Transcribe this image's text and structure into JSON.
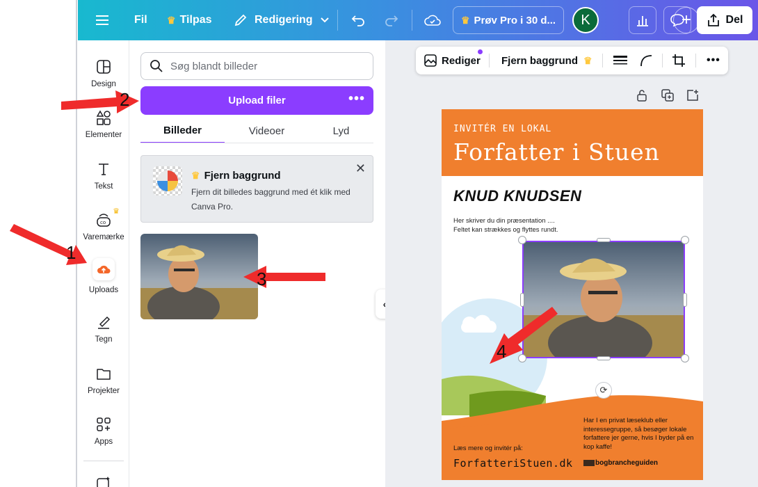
{
  "topbar": {
    "menu_icon": "hamburger-icon",
    "file_label": "Fil",
    "resize_label": "Tilpas",
    "editing_label": "Redigering",
    "try_pro_label": "Prøv Pro i 30 d...",
    "avatar_letter": "K",
    "share_label": "Del",
    "gradient_start": "#18b9cf",
    "gradient_end": "#6a55e8"
  },
  "sidebar": {
    "items": [
      {
        "label": "Design",
        "icon": "layout-icon"
      },
      {
        "label": "Elementer",
        "icon": "shapes-icon"
      },
      {
        "label": "Tekst",
        "icon": "text-icon"
      },
      {
        "label": "Varemærke",
        "icon": "brand-icon"
      },
      {
        "label": "Uploads",
        "icon": "upload-cloud-icon"
      },
      {
        "label": "Tegn",
        "icon": "draw-icon"
      },
      {
        "label": "Projekter",
        "icon": "folder-icon"
      },
      {
        "label": "Apps",
        "icon": "apps-icon"
      }
    ]
  },
  "panel": {
    "search_placeholder": "Søg blandt billeder",
    "upload_label": "Upload filer",
    "tabs": [
      "Billeder",
      "Videoer",
      "Lyd"
    ],
    "promo": {
      "title": "Fjern baggrund",
      "text": "Fjern dit billedes baggrund med ét klik med Canva Pro."
    }
  },
  "context_toolbar": {
    "edit_label": "Rediger",
    "remove_bg_label": "Fjern baggrund"
  },
  "poster": {
    "subtitle": "INVITÉR EN LOKAL",
    "title": "Forfatter i Stuen",
    "author": "KNUD KNUDSEN",
    "intro_line1": "Her skriver du din præsentation ....",
    "intro_line2": "Feltet kan strækkes og flyttes rundt.",
    "right_text": "Har I en privat læseklub eller interessegruppe, så besøger lokale forfattere jer gerne, hvis I byder på en kop kaffe!",
    "read_more": "Læs mere og invitér på:",
    "website": "ForfatteriStuen.dk",
    "logo_text": "bogbrancheguiden",
    "accent_color": "#f07f2e"
  },
  "annotations": {
    "n1": "1",
    "n2": "2",
    "n3": "3",
    "n4": "4",
    "arrow_color": "#ef2b2b"
  }
}
